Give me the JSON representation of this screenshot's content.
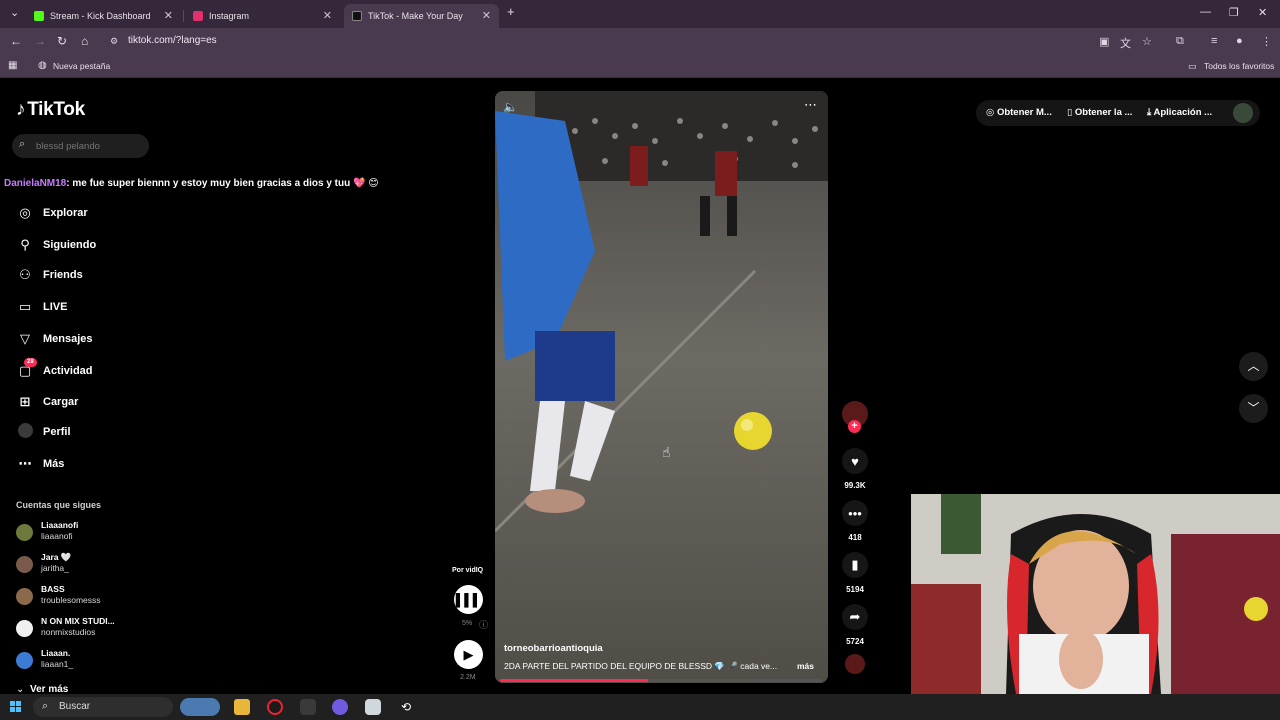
{
  "browser": {
    "tabs": [
      {
        "title": "Stream - Kick Dashboard",
        "favicon_color": "#53fc18",
        "active": false
      },
      {
        "title": "Instagram",
        "favicon_color": "#e1306c",
        "active": false
      },
      {
        "title": "TikTok - Make Your Day",
        "favicon_color": "#111111",
        "active": true
      }
    ],
    "new_tab_icon": "plus-icon",
    "url": "tiktok.com/?lang=es",
    "bookmarks": {
      "new_tab": "Nueva pestaña",
      "all_favorites": "Todos los favoritos"
    }
  },
  "tiktok": {
    "logo": "TikTok",
    "search_placeholder": "blessd pelando",
    "chat": {
      "user": "DanielaNM18",
      "message": ": me fue super biennn y estoy muy bien gracias a dios y tuu 💖 😊"
    },
    "nav": [
      {
        "label": "Explorar",
        "icon": "compass-icon"
      },
      {
        "label": "Siguiendo",
        "icon": "user-follow-icon"
      },
      {
        "label": "Friends",
        "icon": "friends-icon"
      },
      {
        "label": "LIVE",
        "icon": "live-icon"
      },
      {
        "label": "Mensajes",
        "icon": "send-icon"
      },
      {
        "label": "Actividad",
        "icon": "inbox-icon",
        "badge": "28"
      },
      {
        "label": "Cargar",
        "icon": "upload-icon"
      },
      {
        "label": "Perfil",
        "icon": "avatar-icon"
      },
      {
        "label": "Más",
        "icon": "more-icon"
      }
    ],
    "following_title": "Cuentas que sigues",
    "following": [
      {
        "name": "Liaaanofi",
        "handle": "liaaanofi",
        "color": "#6b7a3a"
      },
      {
        "name": "Jara 🤍",
        "handle": "jaritha_",
        "color": "#7a5a4a"
      },
      {
        "name": "BASS",
        "handle": "troublesomesss",
        "color": "#8a6a4a"
      },
      {
        "name": "N ON MIX STUDI...",
        "handle": "nonmixstudios",
        "color": "#f0f0f0"
      },
      {
        "name": "Liaaan.",
        "handle": "liaaan1_",
        "color": "#3b7bd6"
      }
    ],
    "see_more": "Ver más",
    "top_right": {
      "item1": "Obtener M...",
      "item2": "Obtener la ...",
      "item3": "Aplicación ..."
    },
    "video": {
      "author": "torneobarrioantioquia",
      "description": "2DA PARTE DEL PARTIDO DEL EQUIPO DE BLESSD 💎 🎤 cada ve...",
      "more": "más",
      "progress_fraction": 0.46
    },
    "actions": {
      "likes": "99.3K",
      "comments": "418",
      "saves": "5194",
      "shares": "5724"
    },
    "vidiq": {
      "label": "Por vidIQ",
      "percent": "5%",
      "views": "2.2M"
    }
  },
  "taskbar": {
    "search_label": "Buscar"
  }
}
